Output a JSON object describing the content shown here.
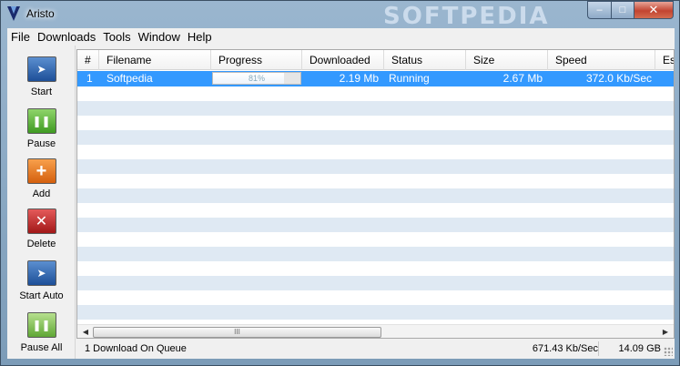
{
  "window": {
    "title": "Aristo",
    "watermark": "SOFTPEDIA",
    "caption": {
      "minimize": "–",
      "maximize": "□",
      "close": "✕"
    }
  },
  "menu": [
    "File",
    "Downloads",
    "Tools",
    "Window",
    "Help"
  ],
  "toolbar": [
    {
      "label": "Start",
      "icon": "play-arrow-icon",
      "glyph": "➤"
    },
    {
      "label": "Pause",
      "icon": "pause-icon",
      "glyph": "❚❚"
    },
    {
      "label": "Add",
      "icon": "plus-icon",
      "glyph": "+"
    },
    {
      "label": "Delete",
      "icon": "x-icon",
      "glyph": "✕"
    },
    {
      "label": "Start Auto",
      "icon": "play-auto-icon",
      "glyph": "➤"
    },
    {
      "label": "Pause All",
      "icon": "pause-all-icon",
      "glyph": "❚❚"
    }
  ],
  "table": {
    "columns": [
      "#",
      "Filename",
      "Progress",
      "Downloaded",
      "Status",
      "Size",
      "Speed",
      "Es"
    ],
    "rows": [
      {
        "index": "1",
        "filename": "Softpedia",
        "progress_value": 0.81,
        "progress_text": "81%",
        "downloaded": "2.19 Mb",
        "status": "Running",
        "size": "2.67 Mb",
        "speed": "372.0 Kb/Sec"
      }
    ],
    "scroll_thumb": "III"
  },
  "statusbar": {
    "queue": "1 Download On Queue",
    "speed": "671.43 Kb/Sec",
    "size": "14.09 GB"
  },
  "colors": {
    "selection": "#3399ff",
    "alt_row": "#dfe9f3"
  }
}
